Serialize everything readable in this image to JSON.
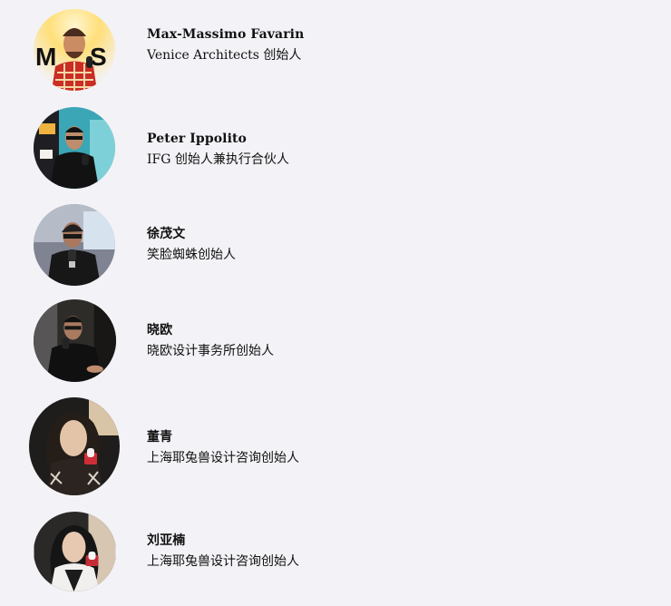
{
  "speakers": [
    {
      "name": "Max-Massimo Favarin",
      "title": "Venice Architects 创始人",
      "photo_icon": "speaker-portrait-photo"
    },
    {
      "name": "Peter Ippolito",
      "title": "IFG 创始人兼执行合伙人",
      "photo_icon": "speaker-portrait-photo"
    },
    {
      "name": "徐茂文",
      "title": "笑脸蜘蛛创始人",
      "photo_icon": "speaker-portrait-photo"
    },
    {
      "name": "晓欧",
      "title": "晓欧设计事务所创始人",
      "photo_icon": "speaker-portrait-photo"
    },
    {
      "name": "董青",
      "title": "上海耶兔兽设计咨询创始人",
      "photo_icon": "speaker-portrait-photo"
    },
    {
      "name": "刘亚楠",
      "title": "上海耶兔兽设计咨询创始人",
      "photo_icon": "speaker-portrait-photo"
    }
  ],
  "colors": {
    "background": "#f3f2f6",
    "text": "#111111"
  }
}
